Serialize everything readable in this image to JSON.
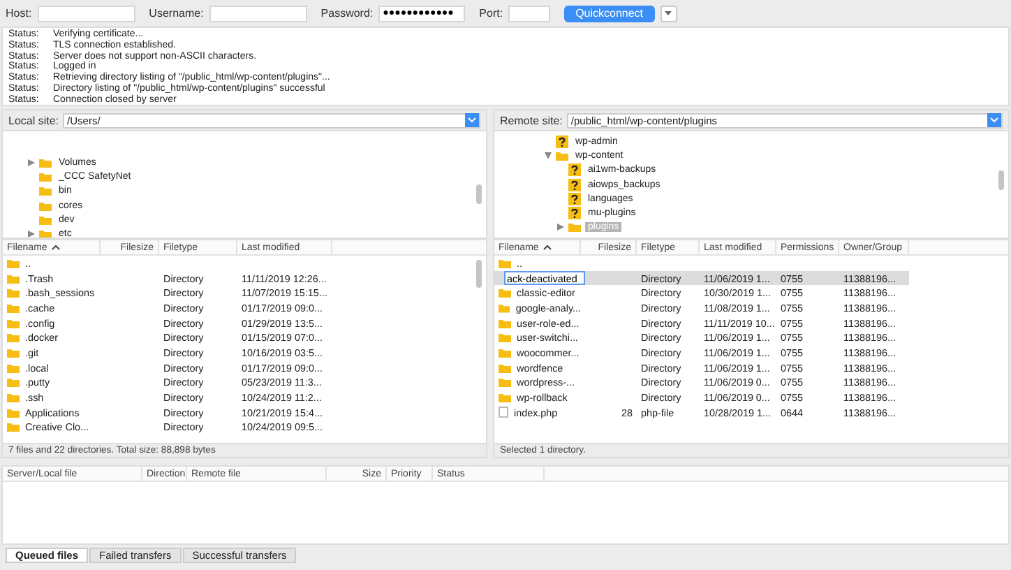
{
  "toolbar": {
    "fields": [
      {
        "label": "Host:",
        "kind": "text"
      },
      {
        "label": "Username:",
        "kind": "text"
      },
      {
        "label": "Password:",
        "value": "●●●●●●●●●●●●",
        "kind": "password"
      },
      {
        "label": "Port:",
        "kind": "port"
      }
    ],
    "button": "Quickconnect"
  },
  "log": [
    {
      "label": "Status:",
      "message": "Verifying certificate..."
    },
    {
      "label": "Status:",
      "message": "TLS connection established."
    },
    {
      "label": "Status:",
      "message": "Server does not support non-ASCII characters."
    },
    {
      "label": "Status:",
      "message": "Logged in"
    },
    {
      "label": "Status:",
      "message": "Retrieving directory listing of \"/public_html/wp-content/plugins\"..."
    },
    {
      "label": "Status:",
      "message": "Directory listing of \"/public_html/wp-content/plugins\" successful"
    },
    {
      "label": "Status:",
      "message": "Connection closed by server"
    }
  ],
  "local": {
    "site_label": "Local site:",
    "path": "/Users/",
    "tree": [
      {
        "name": "Volumes",
        "kind": "collapsed-folder",
        "selected": false
      },
      {
        "name": "_CCC SafetyNet",
        "kind": "folder",
        "selected": false
      },
      {
        "name": "bin",
        "kind": "folder",
        "selected": false
      },
      {
        "name": "cores",
        "kind": "folder",
        "selected": false
      },
      {
        "name": "dev",
        "kind": "folder",
        "selected": false
      },
      {
        "name": "etc",
        "kind": "collapsed-folder",
        "selected": false
      }
    ],
    "columns": [
      "Filename",
      "Filesize",
      "Filetype",
      "Last modified"
    ],
    "rows": [
      {
        "kind": "folder",
        "name": "..",
        "selected": false
      },
      {
        "kind": "folder",
        "name": ".Trash",
        "type": "Directory",
        "modified": "11/11/2019 12:26...",
        "selected": false
      },
      {
        "kind": "folder",
        "name": ".bash_sessions",
        "type": "Directory",
        "modified": "11/07/2019 15:15...",
        "selected": false
      },
      {
        "kind": "folder",
        "name": ".cache",
        "type": "Directory",
        "modified": "01/17/2019 09:0...",
        "selected": false
      },
      {
        "kind": "folder",
        "name": ".config",
        "type": "Directory",
        "modified": "01/29/2019 13:5...",
        "selected": false
      },
      {
        "kind": "folder",
        "name": ".docker",
        "type": "Directory",
        "modified": "01/15/2019 07:0...",
        "selected": false
      },
      {
        "kind": "folder",
        "name": ".git",
        "type": "Directory",
        "modified": "10/16/2019 03:5...",
        "selected": false
      },
      {
        "kind": "folder",
        "name": ".local",
        "type": "Directory",
        "modified": "01/17/2019 09:0...",
        "selected": false
      },
      {
        "kind": "folder",
        "name": ".putty",
        "type": "Directory",
        "modified": "05/23/2019 11:3...",
        "selected": false
      },
      {
        "kind": "folder",
        "name": ".ssh",
        "type": "Directory",
        "modified": "10/24/2019 11:2...",
        "selected": false
      },
      {
        "kind": "folder",
        "name": "Applications",
        "type": "Directory",
        "modified": "10/21/2019 15:4...",
        "selected": false
      },
      {
        "kind": "folder",
        "name": "Creative Clo...",
        "type": "Directory",
        "modified": "10/24/2019 09:5...",
        "selected": false
      }
    ],
    "status": "7 files and 22 directories. Total size: 88,898 bytes"
  },
  "remote": {
    "site_label": "Remote site:",
    "path": "/public_html/wp-content/plugins",
    "tree": [
      {
        "name": "wp-admin",
        "kind": "unknown-folder",
        "selected": false
      },
      {
        "name": "wp-content",
        "kind": "expanded-folder",
        "selected": false,
        "children": [
          {
            "name": "ai1wm-backups",
            "kind": "unknown-folder",
            "selected": false
          },
          {
            "name": "aiowps_backups",
            "kind": "unknown-folder",
            "selected": false
          },
          {
            "name": "languages",
            "kind": "unknown-folder",
            "selected": false
          },
          {
            "name": "mu-plugins",
            "kind": "unknown-folder",
            "selected": false
          },
          {
            "name": "plugins",
            "kind": "collapsed-folder",
            "selected": true
          }
        ]
      }
    ],
    "columns": [
      "Filename",
      "Filesize",
      "Filetype",
      "Last modified",
      "Permissions",
      "Owner/Group"
    ],
    "rows": [
      {
        "kind": "folder",
        "name": "..",
        "selected": false,
        "editing": false
      },
      {
        "kind": "folder",
        "name": "ack-deactivated",
        "type": "Directory",
        "modified": "11/06/2019 1...",
        "perms": "0755",
        "owner": "11388196...",
        "selected": true,
        "editing": true
      },
      {
        "kind": "folder",
        "name": "classic-editor",
        "type": "Directory",
        "modified": "10/30/2019 1...",
        "perms": "0755",
        "owner": "11388196...",
        "selected": false,
        "editing": false
      },
      {
        "kind": "folder",
        "name": "google-analy...",
        "type": "Directory",
        "modified": "11/08/2019 1...",
        "perms": "0755",
        "owner": "11388196...",
        "selected": false,
        "editing": false
      },
      {
        "kind": "folder",
        "name": "user-role-ed...",
        "type": "Directory",
        "modified": "11/11/2019 10...",
        "perms": "0755",
        "owner": "11388196...",
        "selected": false,
        "editing": false
      },
      {
        "kind": "folder",
        "name": "user-switchi...",
        "type": "Directory",
        "modified": "11/06/2019 1...",
        "perms": "0755",
        "owner": "11388196...",
        "selected": false,
        "editing": false
      },
      {
        "kind": "folder",
        "name": "woocommer...",
        "type": "Directory",
        "modified": "11/06/2019 1...",
        "perms": "0755",
        "owner": "11388196...",
        "selected": false,
        "editing": false
      },
      {
        "kind": "folder",
        "name": "wordfence",
        "type": "Directory",
        "modified": "11/06/2019 1...",
        "perms": "0755",
        "owner": "11388196...",
        "selected": false,
        "editing": false
      },
      {
        "kind": "folder",
        "name": "wordpress-...",
        "type": "Directory",
        "modified": "11/06/2019 0...",
        "perms": "0755",
        "owner": "11388196...",
        "selected": false,
        "editing": false
      },
      {
        "kind": "folder",
        "name": "wp-rollback",
        "type": "Directory",
        "modified": "11/06/2019 0...",
        "perms": "0755",
        "owner": "11388196...",
        "selected": false,
        "editing": false
      },
      {
        "kind": "file",
        "name": "index.php",
        "size": "28",
        "type": "php-file",
        "modified": "10/28/2019 1...",
        "perms": "0644",
        "owner": "11388196...",
        "selected": false,
        "editing": false
      }
    ],
    "status": "Selected 1 directory."
  },
  "queue": {
    "columns": [
      "Server/Local file",
      "Direction",
      "Remote file",
      "Size",
      "Priority",
      "Status"
    ]
  },
  "tabs": [
    {
      "label": "Queued files",
      "selected": true
    },
    {
      "label": "Failed transfers",
      "selected": false
    },
    {
      "label": "Successful transfers",
      "selected": false
    }
  ]
}
